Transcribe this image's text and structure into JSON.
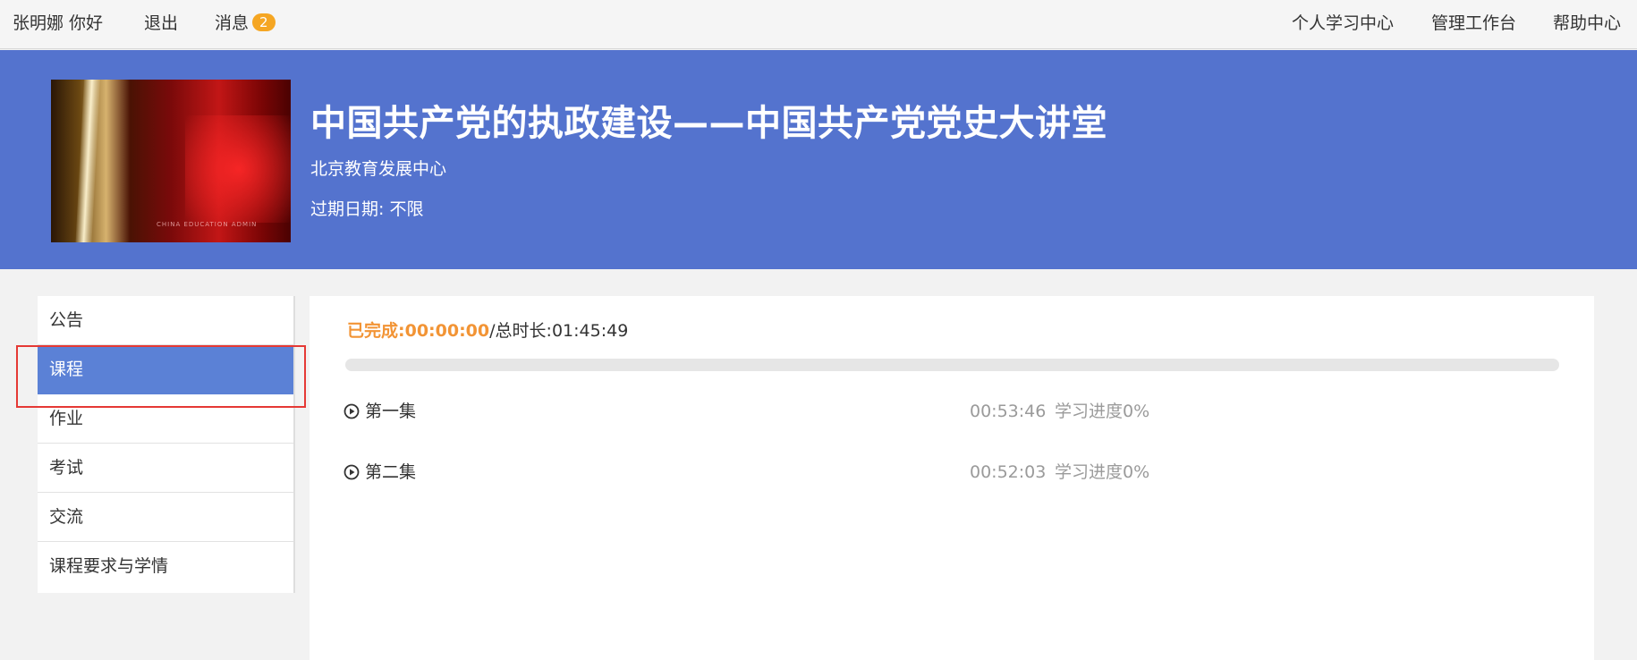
{
  "topbar": {
    "greeting": "张明娜 你好",
    "logout": "退出",
    "messages_label": "消息",
    "messages_count": "2",
    "links": [
      "个人学习中心",
      "管理工作台",
      "帮助中心"
    ]
  },
  "course": {
    "title": "中国共产党的执政建设——中国共产党党史大讲堂",
    "organization": "北京教育发展中心",
    "expiry_label": "过期日期:",
    "expiry_value": "不限"
  },
  "sidebar": {
    "items": [
      {
        "label": "公告"
      },
      {
        "label": "课程"
      },
      {
        "label": "作业"
      },
      {
        "label": "考试"
      },
      {
        "label": "交流"
      },
      {
        "label": "课程要求与学情"
      }
    ],
    "active_index": 1
  },
  "progress": {
    "completed_label": "已完成:",
    "completed_value": "00:00:00",
    "total_label": "/总时长:",
    "total_value": "01:45:49",
    "fraction": 0
  },
  "episodes": [
    {
      "title": "第一集",
      "duration": "00:53:46",
      "progress": "学习进度0%"
    },
    {
      "title": "第二集",
      "duration": "00:52:03",
      "progress": "学习进度0%"
    }
  ],
  "colors": {
    "banner": "#5473ce",
    "active_sidebar": "#5b81d6",
    "accent_orange": "#f29435",
    "badge": "#f5a623",
    "highlight_border": "#e53935"
  },
  "icons": {
    "episode": "play-circle-icon"
  }
}
